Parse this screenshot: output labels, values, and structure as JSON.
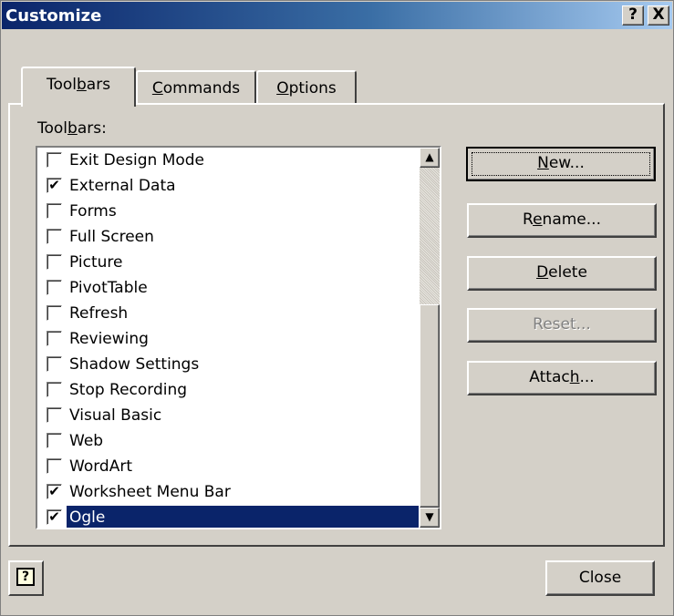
{
  "window": {
    "title": "Customize",
    "help_glyph": "?",
    "close_glyph": "X"
  },
  "tabs": [
    {
      "pre": "Tool",
      "key": "b",
      "post": "ars",
      "active": true
    },
    {
      "pre": "",
      "key": "C",
      "post": "ommands",
      "active": false
    },
    {
      "pre": "",
      "key": "O",
      "post": "ptions",
      "active": false
    }
  ],
  "list_label": {
    "pre": "Tool",
    "key": "b",
    "post": "ars:"
  },
  "toolbars": [
    {
      "label": "Exit Design Mode",
      "checked": false,
      "selected": false
    },
    {
      "label": "External Data",
      "checked": true,
      "selected": false
    },
    {
      "label": "Forms",
      "checked": false,
      "selected": false
    },
    {
      "label": "Full Screen",
      "checked": false,
      "selected": false
    },
    {
      "label": "Picture",
      "checked": false,
      "selected": false
    },
    {
      "label": "PivotTable",
      "checked": false,
      "selected": false
    },
    {
      "label": "Refresh",
      "checked": false,
      "selected": false
    },
    {
      "label": "Reviewing",
      "checked": false,
      "selected": false
    },
    {
      "label": "Shadow Settings",
      "checked": false,
      "selected": false
    },
    {
      "label": "Stop Recording",
      "checked": false,
      "selected": false
    },
    {
      "label": "Visual Basic",
      "checked": false,
      "selected": false
    },
    {
      "label": "Web",
      "checked": false,
      "selected": false
    },
    {
      "label": "WordArt",
      "checked": false,
      "selected": false
    },
    {
      "label": "Worksheet Menu Bar",
      "checked": true,
      "selected": false
    },
    {
      "label": "Ogle",
      "checked": true,
      "selected": true
    }
  ],
  "buttons": {
    "new": {
      "pre": "",
      "key": "N",
      "post": "ew..."
    },
    "rename": {
      "pre": "R",
      "key": "e",
      "post": "name..."
    },
    "delete": {
      "pre": "",
      "key": "D",
      "post": "elete"
    },
    "reset": {
      "pre": "Reset...",
      "key": "",
      "post": ""
    },
    "attach": {
      "pre": "Attac",
      "key": "h",
      "post": "..."
    }
  },
  "help_button_glyph": "?",
  "close_label": "Close",
  "scroll_up_glyph": "▲",
  "scroll_down_glyph": "▼",
  "check_glyph": "✔"
}
